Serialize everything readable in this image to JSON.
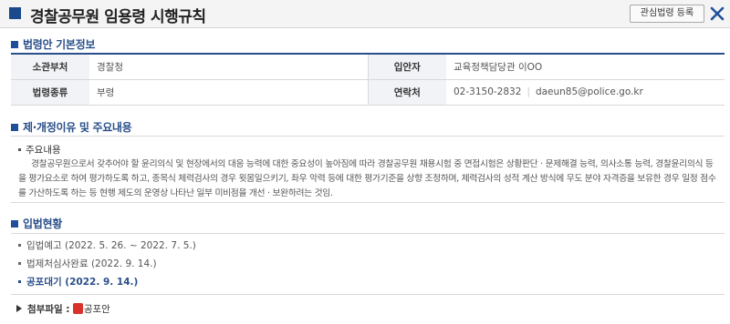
{
  "header": {
    "title": "경찰공무원 임용령 시행규칙",
    "fav_button_label": "관심법령 등록",
    "close_label": "닫기"
  },
  "basic_info": {
    "section_title": "법령안 기본정보",
    "rows": [
      {
        "label1": "소관부처",
        "value1": "경찰청",
        "label2": "입안자",
        "value2": "교육정책담당관 이OO"
      },
      {
        "label1": "법령종류",
        "value1": "부령",
        "label2": "연락처",
        "value2": "02-3150-2832",
        "value3": "daeun85@police.go.kr"
      }
    ]
  },
  "reason": {
    "section_title": "제·개정이유 및 주요내용",
    "subtitle": "주요내용",
    "text": "경찰공무원으로서 갖추어야 할 윤리의식 및 현장에서의 대응 능력에 대한 중요성이 높아짐에 따라 경찰공무원 채용시험 중 면접시험은 상황판단 · 문제해결 능력, 의사소통 능력, 경찰윤리의식 등을 평가요소로 하여 평가하도록 하고, 종목식 체력검사의 경우 윗몸일으키기, 좌우 악력 등에 대한 평가기준을 상향 조정하며, 체력검사의 성적 계산 방식에 무도 분야 자격증을 보유한 경우 일정 점수를 가산하도록 하는 등 현행 제도의 운영상 나타난 일부 미비점을 개선 · 보완하려는 것임."
  },
  "status": {
    "section_title": "입법현황",
    "items": [
      {
        "label": "입법예고 (2022. 5. 26. ~ 2022. 7. 5.)",
        "current": false
      },
      {
        "label": "법제처심사완료 (2022. 9. 14.)",
        "current": false
      },
      {
        "label": "공포대기 (2022. 9. 14.)",
        "current": true
      }
    ]
  },
  "attachment": {
    "label": "첨부파일 :",
    "file_name": "공포안"
  },
  "colors": {
    "accent": "#2a4f8a",
    "header_bg": "#f4f4f4",
    "pdf_icon": "#d8322c"
  }
}
